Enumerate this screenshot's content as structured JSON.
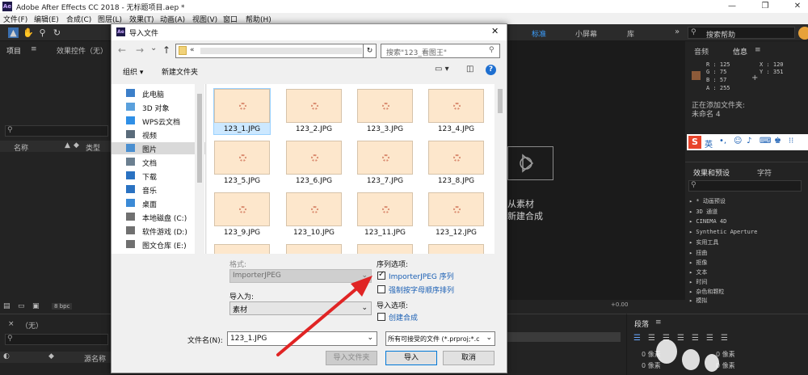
{
  "window": {
    "app_logo": "Ae",
    "title": "Adobe After Effects CC 2018 - 无标题项目.aep *",
    "minimize": "—",
    "maximize": "❐",
    "close": "✕"
  },
  "menu": [
    "文件(F)",
    "编辑(E)",
    "合成(C)",
    "图层(L)",
    "效果(T)",
    "动画(A)",
    "视图(V)",
    "窗口",
    "帮助(H)"
  ],
  "toolbar": {
    "workspaces": [
      "标准",
      "小屏幕",
      "库"
    ],
    "workspace_menu": "»",
    "search_placeholder": "搜索帮助"
  },
  "project_panel": {
    "tab_project": "项目",
    "tab_effects_controls": "效果控件（无）",
    "col_name": "名称",
    "col_type": "类型",
    "bpc": "8 bpc"
  },
  "info_panel": {
    "tab_audio": "音频",
    "tab_info": "信息",
    "swatch_color": "#8c5a39",
    "r": "R : 125",
    "g": "G : 75",
    "b": "B : 57",
    "a": "A : 255",
    "x": "X : 120",
    "y": "Y : 351",
    "status_line1": "正在添加文件夹:",
    "status_line2": "未命名 4"
  },
  "ime_bar": {
    "logo": "S",
    "lang": "英"
  },
  "effects_panel": {
    "tab_effects": "效果和预设",
    "tab_char": "字符",
    "items": [
      "▸ * 动画预设",
      "▸ 3D 通道",
      "▸ CINEMA 4D",
      "▸ Synthetic Aperture",
      "▸ 实用工具",
      "▸ 扭曲",
      "▸ 抠像",
      "▸ 文本",
      "▸ 时间",
      "▸ 杂色和颗粒",
      "▸ 模拟"
    ]
  },
  "viewer": {
    "line1": "从素材",
    "line2": "新建合成"
  },
  "paragraph_panel": {
    "tab": "段落",
    "px1": "0 像素",
    "px2": "0 像素",
    "px3": "0 像素",
    "px4": "0 像素"
  },
  "timeline": {
    "comp": "（无）",
    "col_source": "源名称",
    "zoom": "+0.00"
  },
  "dialog": {
    "logo": "Ae",
    "title": "导入文件",
    "close": "✕",
    "back": "←",
    "forward": "→",
    "dropdown": "⌄",
    "up": "↑",
    "path_prefix": "«",
    "refresh": "↻",
    "search_placeholder": "搜索\"123_看图王\"",
    "organize": "组织 ▾",
    "new_folder": "新建文件夹",
    "help": "?",
    "nav": [
      {
        "label": "此电脑",
        "color": "#3c7fc9"
      },
      {
        "label": "3D 对象",
        "color": "#5aa0dc"
      },
      {
        "label": "WPS云文档",
        "color": "#2f8fe6"
      },
      {
        "label": "视频",
        "color": "#5a6b7a"
      },
      {
        "label": "图片",
        "color": "#4a8fd0"
      },
      {
        "label": "文档",
        "color": "#6b7f90"
      },
      {
        "label": "下载",
        "color": "#2a72c2"
      },
      {
        "label": "音乐",
        "color": "#2a72c2"
      },
      {
        "label": "桌面",
        "color": "#3b8ad6"
      },
      {
        "label": "本地磁盘 (C:)",
        "color": "#707070"
      },
      {
        "label": "软件游戏 (D:)",
        "color": "#707070"
      },
      {
        "label": "图文仓库 (E:)",
        "color": "#707070"
      }
    ],
    "files": [
      "123_1.JPG",
      "123_2.JPG",
      "123_3.JPG",
      "123_4.JPG",
      "123_5.JPG",
      "123_6.JPG",
      "123_7.JPG",
      "123_8.JPG",
      "123_9.JPG",
      "123_10.JPG",
      "123_11.JPG",
      "123_12.JPG",
      "",
      "",
      "",
      ""
    ],
    "format_label": "格式:",
    "format_value": "ImporterJPEG",
    "import_as_label": "导入为:",
    "import_as_value": "素材",
    "sequence_label": "序列选项:",
    "sequence_check": "ImporterJPEG 序列",
    "alpha_order_check": "强制按字母顺序排列",
    "import_options_label": "导入选项:",
    "create_comp_check": "创建合成",
    "filename_label": "文件名(N):",
    "filename_value": "123_1.JPG",
    "filetype_value": "所有可接受的文件 (*.prproj;*.c",
    "import_folder_btn": "导入文件夹",
    "import_btn": "导入",
    "cancel_btn": "取消"
  }
}
